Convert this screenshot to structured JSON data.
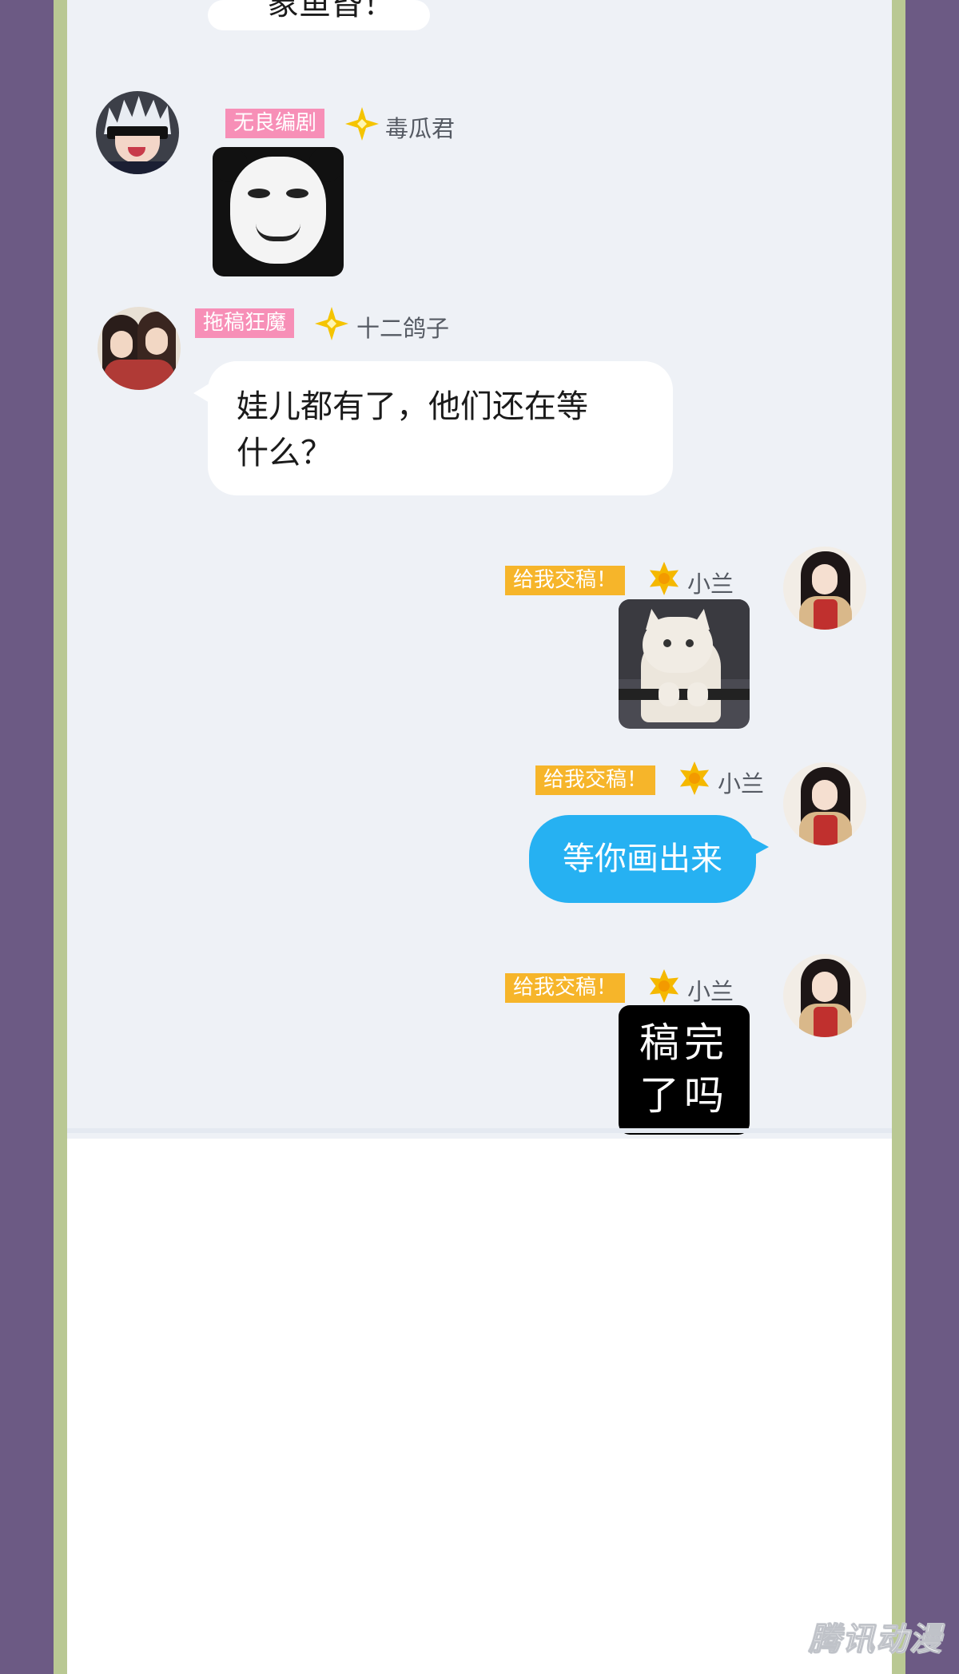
{
  "messages": [
    {
      "id": "top-partial",
      "text": "象鱼昏！"
    },
    {
      "id": "m1",
      "badge": "无良编剧",
      "name": "毒瓜君",
      "content": "sticker",
      "sticker": "panda-face"
    },
    {
      "id": "m2",
      "badge": "拖稿狂魔",
      "name": "十二鸽子",
      "text": "娃儿都有了，他们还在等\n什么？"
    },
    {
      "id": "m3",
      "badge": "给我交稿！",
      "name": "小兰",
      "content": "sticker",
      "sticker": "cat-peeking"
    },
    {
      "id": "m4",
      "badge": "给我交稿！",
      "name": "小兰",
      "text": "等你画出来"
    },
    {
      "id": "m5",
      "badge": "给我交稿！",
      "name": "小兰",
      "sticker_text": "稿完\n了吗"
    }
  ],
  "watermark": "腾讯动漫",
  "colors": {
    "outer_bg": "#6c5a84",
    "frame": "#b9c893",
    "chat_bg": "#eef1f6",
    "badge_pink": "#f78fb7",
    "badge_yellow": "#f6b52a",
    "bubble_blue": "#26b1f2"
  }
}
